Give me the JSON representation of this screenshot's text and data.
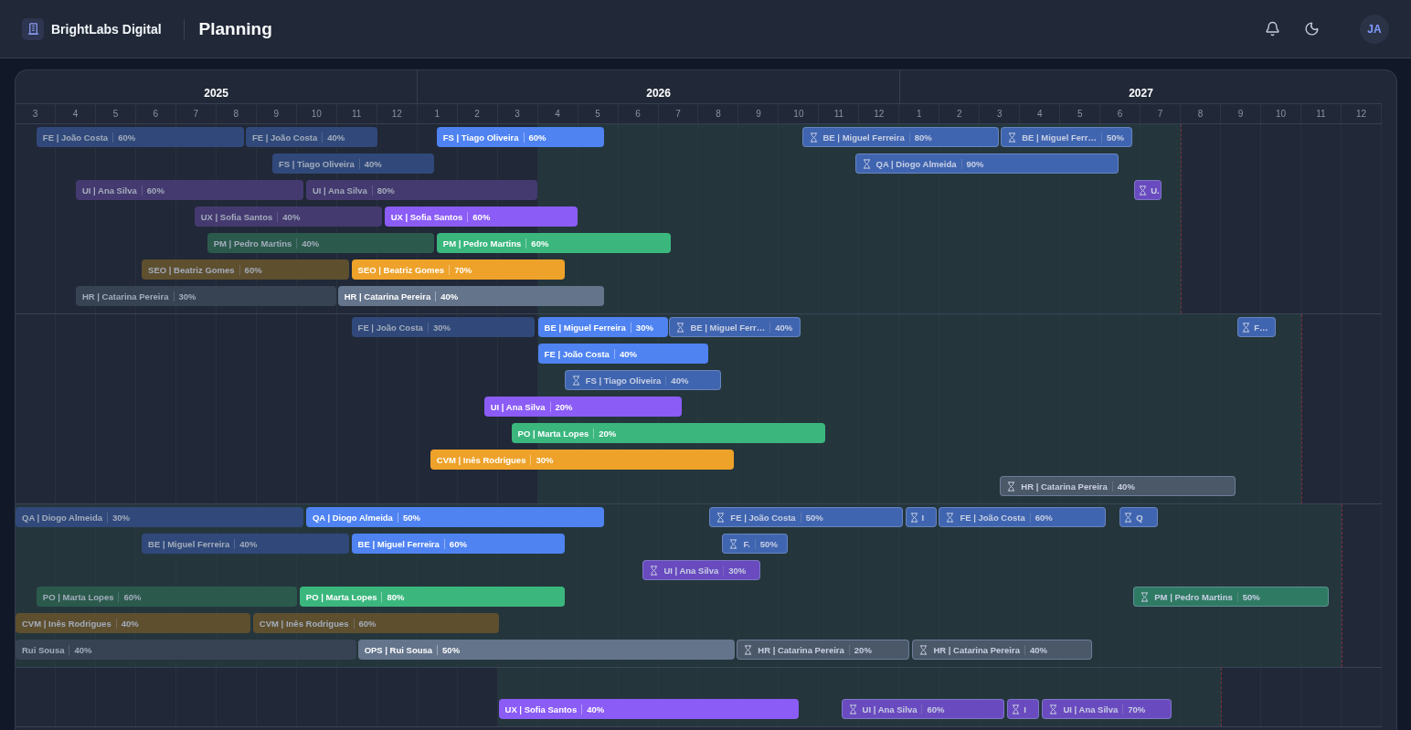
{
  "header": {
    "brand": "BrightLabs Digital",
    "title": "Planning",
    "avatar": "JA"
  },
  "timeline": {
    "years": [
      {
        "label": "2025",
        "months": [
          "3",
          "4",
          "5",
          "6",
          "7",
          "8",
          "9",
          "10",
          "11",
          "12"
        ]
      },
      {
        "label": "2026",
        "months": [
          "1",
          "2",
          "3",
          "4",
          "5",
          "6",
          "7",
          "8",
          "9",
          "10",
          "11",
          "12"
        ]
      },
      {
        "label": "2027",
        "months": [
          "1",
          "2",
          "3",
          "4",
          "5",
          "6",
          "7",
          "8",
          "9",
          "10",
          "11",
          "12"
        ]
      }
    ]
  },
  "sections": [
    {
      "rows": [
        {
          "bars": [
            {
              "kind": "past",
              "label": "FE | João Costa",
              "pct": "60%",
              "color": "#30497a"
            },
            {
              "kind": "past",
              "label": "FE | João Costa",
              "pct": "40%",
              "color": "#30497a"
            },
            {
              "kind": "active",
              "label": "FS | Tiago Oliveira",
              "pct": "60%",
              "color": "#4f83f1"
            },
            {
              "kind": "planned",
              "label": "BE | Miguel Ferreira",
              "pct": "80%",
              "color": "#4065b0"
            },
            {
              "kind": "planned",
              "label": "BE | Miguel Ferr…",
              "pct": "50%",
              "color": "#4065b0"
            }
          ]
        },
        {
          "bars": [
            {
              "kind": "past",
              "label": "FS | Tiago Oliveira",
              "pct": "40%",
              "color": "#30497a"
            },
            {
              "kind": "planned",
              "label": "QA | Diogo Almeida",
              "pct": "90%",
              "color": "#4065b0"
            }
          ]
        },
        {
          "bars": [
            {
              "kind": "past",
              "label": "UI | Ana Silva",
              "pct": "60%",
              "color": "#443a70"
            },
            {
              "kind": "past",
              "label": "UI | Ana Silva",
              "pct": "80%",
              "color": "#443a70"
            },
            {
              "kind": "planned",
              "label": "U.",
              "color": "#6a4bbf"
            }
          ]
        },
        {
          "bars": [
            {
              "kind": "past",
              "label": "UX | Sofia Santos",
              "pct": "40%",
              "color": "#443a70"
            },
            {
              "kind": "active",
              "label": "UX | Sofia Santos",
              "pct": "60%",
              "color": "#8b5cf6"
            }
          ]
        },
        {
          "bars": [
            {
              "kind": "past",
              "label": "PM | Pedro Martins",
              "pct": "40%",
              "color": "#2b5a4d"
            },
            {
              "kind": "active",
              "label": "PM | Pedro Martins",
              "pct": "60%",
              "color": "#3bb77e"
            }
          ]
        },
        {
          "bars": [
            {
              "kind": "past",
              "label": "SEO | Beatriz Gomes",
              "pct": "60%",
              "color": "#5e4f2f"
            },
            {
              "kind": "active",
              "label": "SEO | Beatriz Gomes",
              "pct": "70%",
              "color": "#eea22a"
            }
          ]
        },
        {
          "bars": [
            {
              "kind": "past",
              "label": "HR | Catarina Pereira",
              "pct": "30%",
              "color": "#374353"
            },
            {
              "kind": "active",
              "label": "HR | Catarina Pereira",
              "pct": "40%",
              "color": "#64748b"
            }
          ]
        }
      ]
    },
    {
      "rows": [
        {
          "bars": [
            {
              "kind": "past",
              "label": "FE | João Costa",
              "pct": "30%",
              "color": "#30497a"
            },
            {
              "kind": "active",
              "label": "BE | Miguel Ferreira",
              "pct": "30%",
              "color": "#4f83f1"
            },
            {
              "kind": "planned",
              "label": "BE | Miguel Ferr…",
              "pct": "40%",
              "color": "#4065b0"
            },
            {
              "kind": "planned",
              "label": "F…",
              "color": "#4065b0"
            }
          ]
        },
        {
          "bars": [
            {
              "kind": "active",
              "label": "FE | João Costa",
              "pct": "40%",
              "color": "#4f83f1"
            }
          ]
        },
        {
          "bars": [
            {
              "kind": "planned",
              "label": "FS | Tiago Oliveira",
              "pct": "40%",
              "color": "#4065b0"
            }
          ]
        },
        {
          "bars": [
            {
              "kind": "active",
              "label": "UI | Ana Silva",
              "pct": "20%",
              "color": "#8b5cf6"
            }
          ]
        },
        {
          "bars": [
            {
              "kind": "active",
              "label": "PO | Marta Lopes",
              "pct": "20%",
              "color": "#3bb77e"
            }
          ]
        },
        {
          "bars": [
            {
              "kind": "active",
              "label": "CVM | Inês Rodrigues",
              "pct": "30%",
              "color": "#eea22a"
            }
          ]
        },
        {
          "bars": [
            {
              "kind": "planned",
              "label": "HR | Catarina Pereira",
              "pct": "40%",
              "color": "#4b5868"
            }
          ]
        }
      ]
    },
    {
      "rows": [
        {
          "bars": [
            {
              "kind": "past",
              "label": "QA | Diogo Almeida",
              "pct": "30%",
              "color": "#30497a"
            },
            {
              "kind": "active",
              "label": "QA | Diogo Almeida",
              "pct": "50%",
              "color": "#4f83f1"
            },
            {
              "kind": "planned",
              "label": "FE | João Costa",
              "pct": "50%",
              "color": "#4065b0"
            },
            {
              "kind": "planned",
              "label": "I",
              "color": "#4065b0"
            },
            {
              "kind": "planned",
              "label": "FE | João Costa",
              "pct": "60%",
              "color": "#4065b0"
            },
            {
              "kind": "planned",
              "label": "Q",
              "color": "#4065b0"
            }
          ]
        },
        {
          "bars": [
            {
              "kind": "past",
              "label": "BE | Miguel Ferreira",
              "pct": "40%",
              "color": "#30497a"
            },
            {
              "kind": "active",
              "label": "BE | Miguel Ferreira",
              "pct": "60%",
              "color": "#4f83f1"
            },
            {
              "kind": "planned",
              "label": "F.",
              "pct": "50%",
              "color": "#4065b0"
            }
          ]
        },
        {
          "bars": [
            {
              "kind": "planned",
              "label": "UI | Ana Silva",
              "pct": "30%",
              "color": "#6a4bbf"
            }
          ]
        },
        {
          "bars": [
            {
              "kind": "past",
              "label": "PO | Marta Lopes",
              "pct": "60%",
              "color": "#2b5a4d"
            },
            {
              "kind": "active",
              "label": "PO | Marta Lopes",
              "pct": "80%",
              "color": "#3bb77e"
            },
            {
              "kind": "planned",
              "label": "PM | Pedro Martins",
              "pct": "50%",
              "color": "#2f7a63"
            }
          ]
        },
        {
          "bars": [
            {
              "kind": "past",
              "label": "CVM | Inês Rodrigues",
              "pct": "40%",
              "color": "#5e4f2f"
            },
            {
              "kind": "past",
              "label": "CVM | Inês Rodrigues",
              "pct": "60%",
              "color": "#5e4f2f"
            }
          ]
        },
        {
          "bars": [
            {
              "kind": "past",
              "label": "Rui Sousa",
              "pct": "40%",
              "color": "#374353"
            },
            {
              "kind": "active",
              "label": "OPS | Rui Sousa",
              "pct": "50%",
              "color": "#64748b"
            },
            {
              "kind": "planned",
              "label": "HR | Catarina Pereira",
              "pct": "20%",
              "color": "#4b5868"
            },
            {
              "kind": "planned",
              "label": "HR | Catarina Pereira",
              "pct": "40%",
              "color": "#4b5868"
            }
          ]
        }
      ]
    },
    {
      "rows": [
        {
          "bars": [
            {
              "kind": "active",
              "label": "UX | Sofia Santos",
              "pct": "40%",
              "color": "#8b5cf6"
            },
            {
              "kind": "planned",
              "label": "UI | Ana Silva",
              "pct": "60%",
              "color": "#6a4bbf"
            },
            {
              "kind": "planned",
              "label": "I",
              "color": "#6a4bbf"
            },
            {
              "kind": "planned",
              "label": "UI | Ana Silva",
              "pct": "70%",
              "color": "#6a4bbf"
            }
          ]
        }
      ]
    }
  ]
}
